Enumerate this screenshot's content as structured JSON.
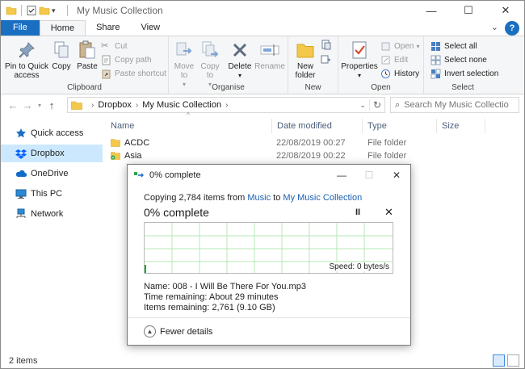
{
  "window": {
    "title": "My Music Collection",
    "minimize": "—",
    "maximize": "☐",
    "close": "✕"
  },
  "tabs": [
    "File",
    "Home",
    "Share",
    "View"
  ],
  "ribbon": {
    "clipboard": {
      "label": "Clipboard",
      "pin": "Pin to Quick access",
      "copy": "Copy",
      "paste": "Paste",
      "cut": "Cut",
      "copy_path": "Copy path",
      "paste_shortcut": "Paste shortcut"
    },
    "organise": {
      "label": "Organise",
      "move_to": "Move to",
      "copy_to": "Copy to",
      "delete": "Delete",
      "rename": "Rename"
    },
    "new": {
      "label": "New",
      "new_folder": "New folder"
    },
    "open": {
      "label": "Open",
      "properties": "Properties",
      "open": "Open",
      "edit": "Edit",
      "history": "History"
    },
    "select": {
      "label": "Select",
      "select_all": "Select all",
      "select_none": "Select none",
      "invert": "Invert selection"
    }
  },
  "address": {
    "crumbs": [
      "Dropbox",
      "My Music Collection"
    ],
    "search_placeholder": "Search My Music Collection"
  },
  "nav": [
    {
      "label": "Quick access",
      "icon": "star-icon"
    },
    {
      "label": "Dropbox",
      "icon": "dropbox-icon",
      "selected": true
    },
    {
      "label": "OneDrive",
      "icon": "cloud-icon"
    },
    {
      "label": "This PC",
      "icon": "computer-icon"
    },
    {
      "label": "Network",
      "icon": "network-icon"
    }
  ],
  "columns": [
    "Name",
    "Date modified",
    "Type",
    "Size"
  ],
  "files": [
    {
      "name": "ACDC",
      "date": "22/08/2019 00:27",
      "type": "File folder"
    },
    {
      "name": "Asia",
      "date": "22/08/2019 00:22",
      "type": "File folder"
    }
  ],
  "status": {
    "items": "2 items"
  },
  "dialog": {
    "title": "0% complete",
    "copying_prefix": "Copying 2,784 items from ",
    "source": "Music",
    "to": " to ",
    "dest": "My Music Collection",
    "percent": "0% complete",
    "pause": "II",
    "stop": "✕",
    "progress_fraction": 0,
    "speed": "Speed: 0 bytes/s",
    "name": "Name:  008 - I Will Be There For You.mp3",
    "time_remaining": "Time remaining:  About 29 minutes",
    "items_remaining": "Items remaining:  2,761 (9.10 GB)",
    "fewer_details": "Fewer details"
  },
  "colors": {
    "accent": "#1a6fc1",
    "folder": "#f4c84a",
    "link": "#1a5fb4",
    "graph_grid": "#b6e8b6",
    "selected_nav": "#cce8ff"
  }
}
